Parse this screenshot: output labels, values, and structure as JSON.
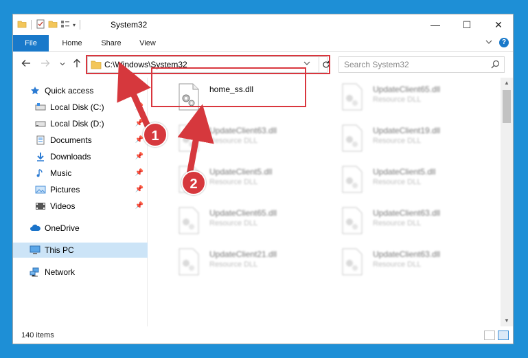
{
  "window": {
    "title": "System32",
    "controls": {
      "minimize": "—",
      "maximize": "☐",
      "close": "✕"
    }
  },
  "ribbon": {
    "tabs": [
      {
        "label": "File"
      },
      {
        "label": "Home"
      },
      {
        "label": "Share"
      },
      {
        "label": "View"
      }
    ],
    "expand_icon": "chevron-down-icon",
    "help_label": "?"
  },
  "navigation": {
    "back_icon": "arrow-left-icon",
    "forward_icon": "arrow-right-icon",
    "recent_icon": "chevron-down-icon",
    "up_icon": "arrow-up-icon",
    "address": "C:\\Windows\\System32",
    "refresh_icon": "refresh-icon",
    "search_placeholder": "Search System32"
  },
  "sidebar": {
    "items": [
      {
        "label": "Quick access",
        "icon": "star-icon",
        "pinned": false
      },
      {
        "label": "Local Disk (C:)",
        "icon": "drive-icon",
        "pinned": true
      },
      {
        "label": "Local Disk (D:)",
        "icon": "drive-icon",
        "pinned": true
      },
      {
        "label": "Documents",
        "icon": "documents-icon",
        "pinned": true
      },
      {
        "label": "Downloads",
        "icon": "download-icon",
        "pinned": true
      },
      {
        "label": "Music",
        "icon": "music-icon",
        "pinned": true
      },
      {
        "label": "Pictures",
        "icon": "pictures-icon",
        "pinned": true
      },
      {
        "label": "Videos",
        "icon": "videos-icon",
        "pinned": true
      },
      {
        "label": "OneDrive",
        "icon": "cloud-icon",
        "pinned": false
      },
      {
        "label": "This PC",
        "icon": "computer-icon",
        "pinned": false,
        "selected": true
      },
      {
        "label": "Network",
        "icon": "network-icon",
        "pinned": false
      }
    ]
  },
  "files": [
    {
      "name": "home_ss.dll",
      "type": "",
      "highlighted": true
    },
    {
      "name": "UpdateClient65.dll",
      "type": "Resource DLL"
    },
    {
      "name": "UpdateClient63.dll",
      "type": "Resource DLL"
    },
    {
      "name": "UpdateClient19.dll",
      "type": "Resource DLL"
    },
    {
      "name": "UpdateClient5.dll",
      "type": "Resource DLL"
    },
    {
      "name": "UpdateClient5.dll",
      "type": "Resource DLL"
    },
    {
      "name": "UpdateClient65.dll",
      "type": "Resource DLL"
    },
    {
      "name": "UpdateClient63.dll",
      "type": "Resource DLL"
    },
    {
      "name": "UpdateClient21.dll",
      "type": "Resource DLL"
    },
    {
      "name": "UpdateClient63.dll",
      "type": "Resource DLL"
    }
  ],
  "status": {
    "item_count": "140 items"
  },
  "annotations": {
    "step1": "1",
    "step2": "2",
    "color": "#d6383d"
  },
  "colors": {
    "accent": "#1979ca",
    "selection": "#cce4f7",
    "highlight": "#d9363e"
  }
}
